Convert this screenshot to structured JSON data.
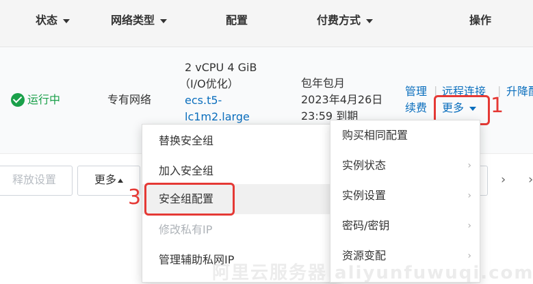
{
  "header": {
    "status": "状态",
    "network_type": "网络类型",
    "config": "配置",
    "payment": "付费方式",
    "actions": "操作"
  },
  "row": {
    "status": "运行中",
    "network": "专有网络",
    "config_line1": "2 vCPU 4 GiB",
    "config_line2": "（I/O优化）",
    "config_line3": "ecs.t5-",
    "config_line4": "lc1m2.large",
    "payment_line1": "包年包月",
    "payment_line2": "2023年4月26日",
    "payment_line3": "23:59 到期",
    "action_manage": "管理",
    "action_renew": "续费",
    "action_remote": "远程连接",
    "action_upgrade": "升降配",
    "action_more": "更多"
  },
  "toolbar": {
    "release_settings": "释放设置",
    "more": "更多"
  },
  "menu": {
    "items": [
      {
        "label": "替换安全组"
      },
      {
        "label": "加入安全组"
      },
      {
        "label": "安全组配置"
      },
      {
        "label": "修改私有IP"
      },
      {
        "label": "管理辅助私网IP"
      }
    ]
  },
  "submenu": {
    "items": [
      {
        "label": "购买相同配置"
      },
      {
        "label": "实例状态"
      },
      {
        "label": "实例设置"
      },
      {
        "label": "密码/密钥"
      },
      {
        "label": "资源变配"
      }
    ]
  },
  "annotations": {
    "step1": "1",
    "step3": "3"
  },
  "watermark": "阿里云服务器 aliyunfuwuqi.com",
  "colors": {
    "accent_red": "#e53935",
    "link_blue": "#0a6ebd",
    "status_green": "#1aa04a"
  }
}
